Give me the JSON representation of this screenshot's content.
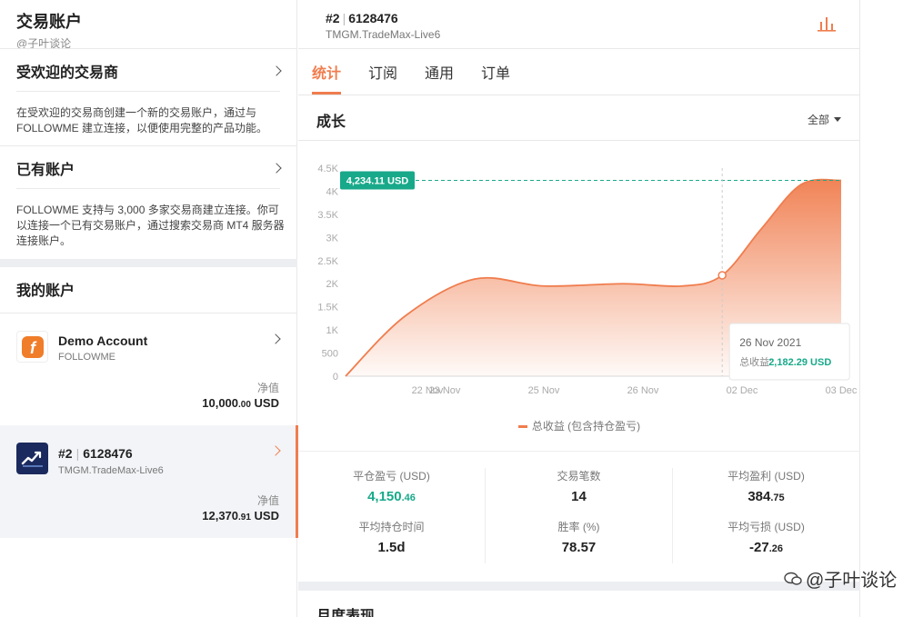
{
  "left": {
    "title": "交易账户",
    "subtitle": "@子叶谈论",
    "popular_brokers": {
      "label": "受欢迎的交易商",
      "desc": "在受欢迎的交易商创建一个新的交易账户，通过与 FOLLOWME 建立连接，以便使用完整的产品功能。"
    },
    "existing": {
      "label": "已有账户",
      "desc": "FOLLOWME 支持与 3,000 多家交易商建立连接。你可以连接一个已有交易账户，通过搜索交易商 MT4 服务器连接账户。"
    },
    "my_accounts_label": "我的账户",
    "accounts": [
      {
        "name": "Demo Account",
        "broker": "FOLLOWME",
        "nv_label": "净值",
        "nv_main": "10,000",
        "nv_dec": ".00",
        "nv_unit": "USD"
      },
      {
        "num": "#2",
        "id": "6128476",
        "broker": "TMGM.TradeMax-Live6",
        "nv_label": "净值",
        "nv_main": "12,370",
        "nv_dec": ".91",
        "nv_unit": "USD"
      }
    ]
  },
  "right": {
    "acct_num": "#2",
    "acct_id": "6128476",
    "broker": "TMGM.TradeMax-Live6",
    "tabs": [
      "统计",
      "订阅",
      "通用",
      "订单"
    ],
    "growth_title": "成长",
    "range": "全部",
    "legend": "总收益 (包含持仓盈亏)",
    "monthly_title": "月度表现"
  },
  "chart_data": {
    "type": "area",
    "title": "",
    "xlabel": "",
    "ylabel": "",
    "ylim": [
      0,
      4500
    ],
    "y_ticks": [
      0,
      500,
      1000,
      1500,
      2000,
      2500,
      3000,
      3500,
      4000,
      4500
    ],
    "y_tick_labels": [
      "0",
      "500",
      "1K",
      "1.5K",
      "2K",
      "2.5K",
      "3K",
      "3.5K",
      "4K",
      "4.5K"
    ],
    "x_tick_labels": [
      "22 Nov",
      "23 Nov",
      "25 Nov",
      "26 Nov",
      "02 Dec",
      "03 Dec"
    ],
    "series": [
      {
        "name": "总收益 (包含持仓盈亏)",
        "x": [
          0,
          0.6,
          1.3,
          2,
          2.8,
          3.4,
          3.8,
          4.2,
          4.6,
          5
        ],
        "values": [
          0,
          1300,
          2100,
          1950,
          2000,
          1950,
          2182.29,
          3200,
          4150,
          4234.11
        ]
      }
    ],
    "last_value_label": "4,234.11 USD",
    "tooltip": {
      "date": "26 Nov 2021",
      "label": "总收益:",
      "value": "2,182.29 USD",
      "x": 3.8,
      "y": 2182.29
    },
    "grid": false,
    "colors": {
      "line": "#f07d4e",
      "fill": "#f9c3a9",
      "marker": "#18a98a"
    }
  },
  "stats": [
    {
      "label": "平仓盈亏 (USD)",
      "main": "4,150",
      "dec": ".46",
      "green": true
    },
    {
      "label": "交易笔数",
      "main": "14",
      "dec": ""
    },
    {
      "label": "平均盈利 (USD)",
      "main": "384",
      "dec": ".75"
    },
    {
      "label": "平均持仓时间",
      "main": "1.5d",
      "dec": ""
    },
    {
      "label": "胜率 (%)",
      "main": "78.57",
      "dec": ""
    },
    {
      "label": "平均亏损 (USD)",
      "main": "-27",
      "dec": ".26"
    }
  ],
  "watermark": "@子叶谈论"
}
